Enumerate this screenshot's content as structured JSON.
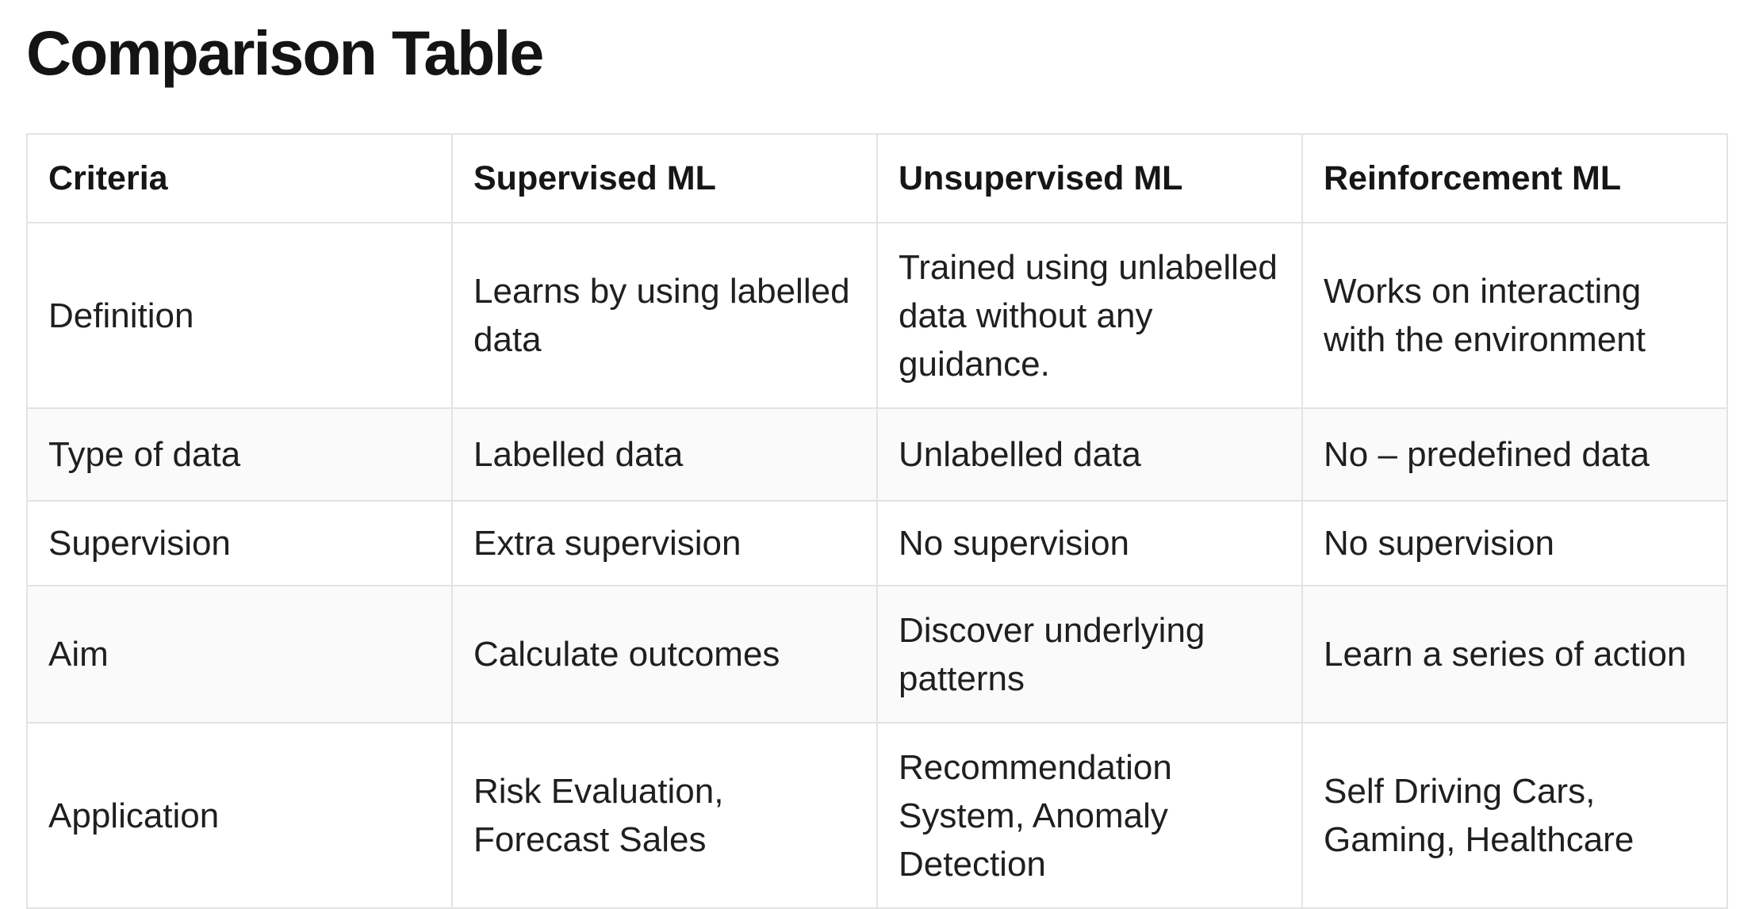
{
  "title": "Comparison Table",
  "table": {
    "headers": [
      "Criteria",
      "Supervised ML",
      "Unsupervised ML",
      "Reinforcement ML"
    ],
    "rows": [
      {
        "criteria": "Definition",
        "supervised": "Learns by using labelled data",
        "unsupervised": "Trained using unlabelled data without any guidance.",
        "reinforcement": "Works on interacting with the environment"
      },
      {
        "criteria": "Type of data",
        "supervised": "Labelled data",
        "unsupervised": "Unlabelled data",
        "reinforcement": "No – predefined data"
      },
      {
        "criteria": "Supervision",
        "supervised": "Extra supervision",
        "unsupervised": "No supervision",
        "reinforcement": "No supervision"
      },
      {
        "criteria": "Aim",
        "supervised": "Calculate outcomes",
        "unsupervised": "Discover underlying patterns",
        "reinforcement": "Learn a series of action"
      },
      {
        "criteria": "Application",
        "supervised": "Risk Evaluation, Forecast Sales",
        "unsupervised": "Recommendation System, Anomaly Detection",
        "reinforcement": "Self Driving Cars, Gaming, Healthcare"
      }
    ]
  }
}
